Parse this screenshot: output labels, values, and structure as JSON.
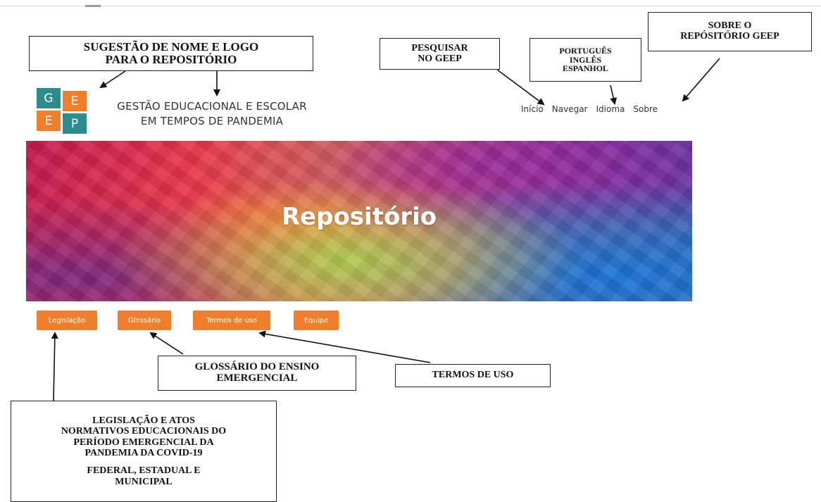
{
  "logo": {
    "tiles": [
      "G",
      "E",
      "E",
      "P"
    ],
    "name_line1": "GESTÃO EDUCACIONAL E ESCOLAR",
    "name_line2": "EM TEMPOS DE PANDEMIA"
  },
  "nav": {
    "items": [
      {
        "label": "Início"
      },
      {
        "label": "Navegar"
      },
      {
        "label": "Idioma"
      },
      {
        "label": "Sobre"
      }
    ]
  },
  "banner": {
    "title": "Repositório"
  },
  "buttons": [
    {
      "label": "Legislação"
    },
    {
      "label": "Glossário"
    },
    {
      "label": "Termos de uso"
    },
    {
      "label": "Equipe"
    }
  ],
  "annotations": {
    "logo_note": [
      "SUGESTÃO DE NOME E LOGO",
      "PARA O REPOSITÓRIO"
    ],
    "search_note": [
      "PESQUISAR",
      "NO GEEP"
    ],
    "language_note": [
      "PORTUGUÊS",
      "INGLÊS",
      "ESPANHOL"
    ],
    "about_note": [
      "SOBRE O",
      "REPÓSITÓRIO GEEP"
    ],
    "glossary_note": [
      "GLOSSÁRIO DO ENSINO",
      "EMERGENCIAL"
    ],
    "terms_note": [
      "TERMOS DE USO"
    ],
    "legislation_note": [
      "LEGISLAÇÃO E ATOS",
      "NORMATIVOS EDUCACIONAIS DO",
      "PERÍODO EMERGENCIAL DA",
      "PANDEMIA DA COVID-19"
    ],
    "legislation_scope": [
      "FEDERAL, ESTADUAL E",
      "MUNICIPAL"
    ]
  },
  "colors": {
    "accent_orange": "#ef7f2c",
    "accent_teal": "#2d8a8d"
  }
}
